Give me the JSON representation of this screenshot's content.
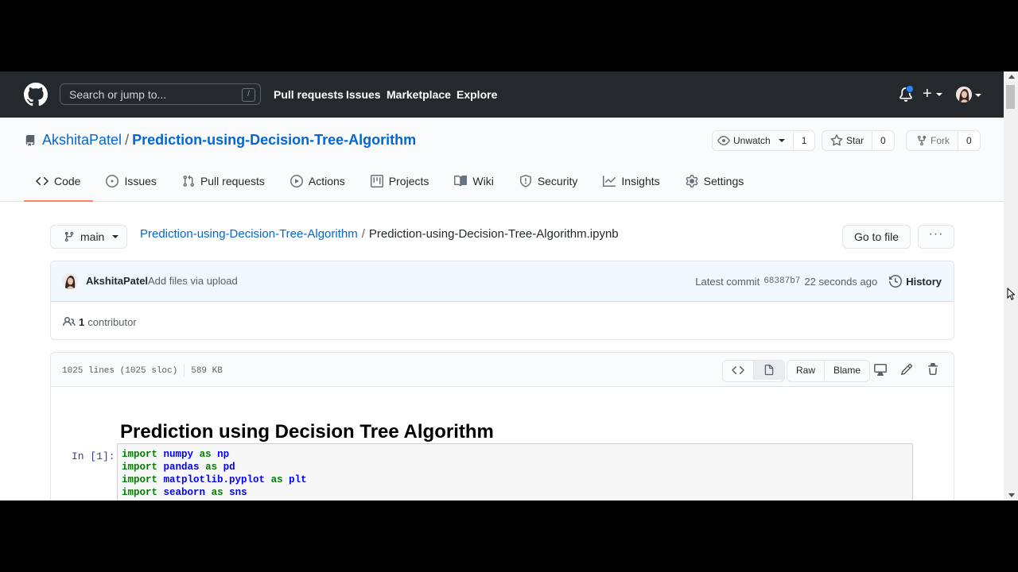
{
  "header": {
    "search_placeholder": "Search or jump to...",
    "search_shortcut": "/",
    "nav": [
      "Pull requests",
      "Issues",
      "Marketplace",
      "Explore"
    ]
  },
  "repo": {
    "owner": "AkshitaPatel",
    "separator": "/",
    "name": "Prediction-using-Decision-Tree-Algorithm",
    "watch_label": "Unwatch",
    "watch_count": "1",
    "star_label": "Star",
    "star_count": "0",
    "fork_label": "Fork",
    "fork_count": "0"
  },
  "tabs": [
    {
      "label": "Code",
      "icon": "code-icon",
      "selected": true
    },
    {
      "label": "Issues",
      "icon": "issue-opened-icon"
    },
    {
      "label": "Pull requests",
      "icon": "git-pull-request-icon"
    },
    {
      "label": "Actions",
      "icon": "play-icon"
    },
    {
      "label": "Projects",
      "icon": "project-icon"
    },
    {
      "label": "Wiki",
      "icon": "book-icon"
    },
    {
      "label": "Security",
      "icon": "shield-icon"
    },
    {
      "label": "Insights",
      "icon": "graph-icon"
    },
    {
      "label": "Settings",
      "icon": "gear-icon"
    }
  ],
  "file_nav": {
    "branch": "main",
    "breadcrumb_repo": "Prediction-using-Decision-Tree-Algorithm",
    "breadcrumb_sep": "/",
    "breadcrumb_file": "Prediction-using-Decision-Tree-Algorithm.ipynb",
    "go_to_file": "Go to file",
    "more": "···"
  },
  "commit": {
    "author": "AkshitaPatel",
    "message": "Add files via upload",
    "latest_label": "Latest commit",
    "sha": "68387b7",
    "time": "22 seconds ago",
    "history": "History",
    "contributors_count": "1",
    "contributors_label": "contributor"
  },
  "file": {
    "lines": "1025 lines (1025 sloc)",
    "size": "589 KB",
    "raw": "Raw",
    "blame": "Blame"
  },
  "notebook": {
    "title": "Prediction using Decision Tree Algorithm",
    "prompt": "In [1]:",
    "code": [
      {
        "kw": "import",
        "mod": "numpy",
        "as": "as",
        "alias": "np"
      },
      {
        "kw": "import",
        "mod": "pandas",
        "as": "as",
        "alias": "pd"
      },
      {
        "kw": "import",
        "mod": "matplotlib.pyplot",
        "as": "as",
        "alias": "plt"
      },
      {
        "kw": "import",
        "mod": "seaborn",
        "as": "as",
        "alias": "sns"
      }
    ]
  },
  "colors": {
    "header_bg": "#24292e",
    "link": "#0366d6",
    "tab_underline": "#f9826c",
    "commit_bg": "#f1f8ff"
  }
}
